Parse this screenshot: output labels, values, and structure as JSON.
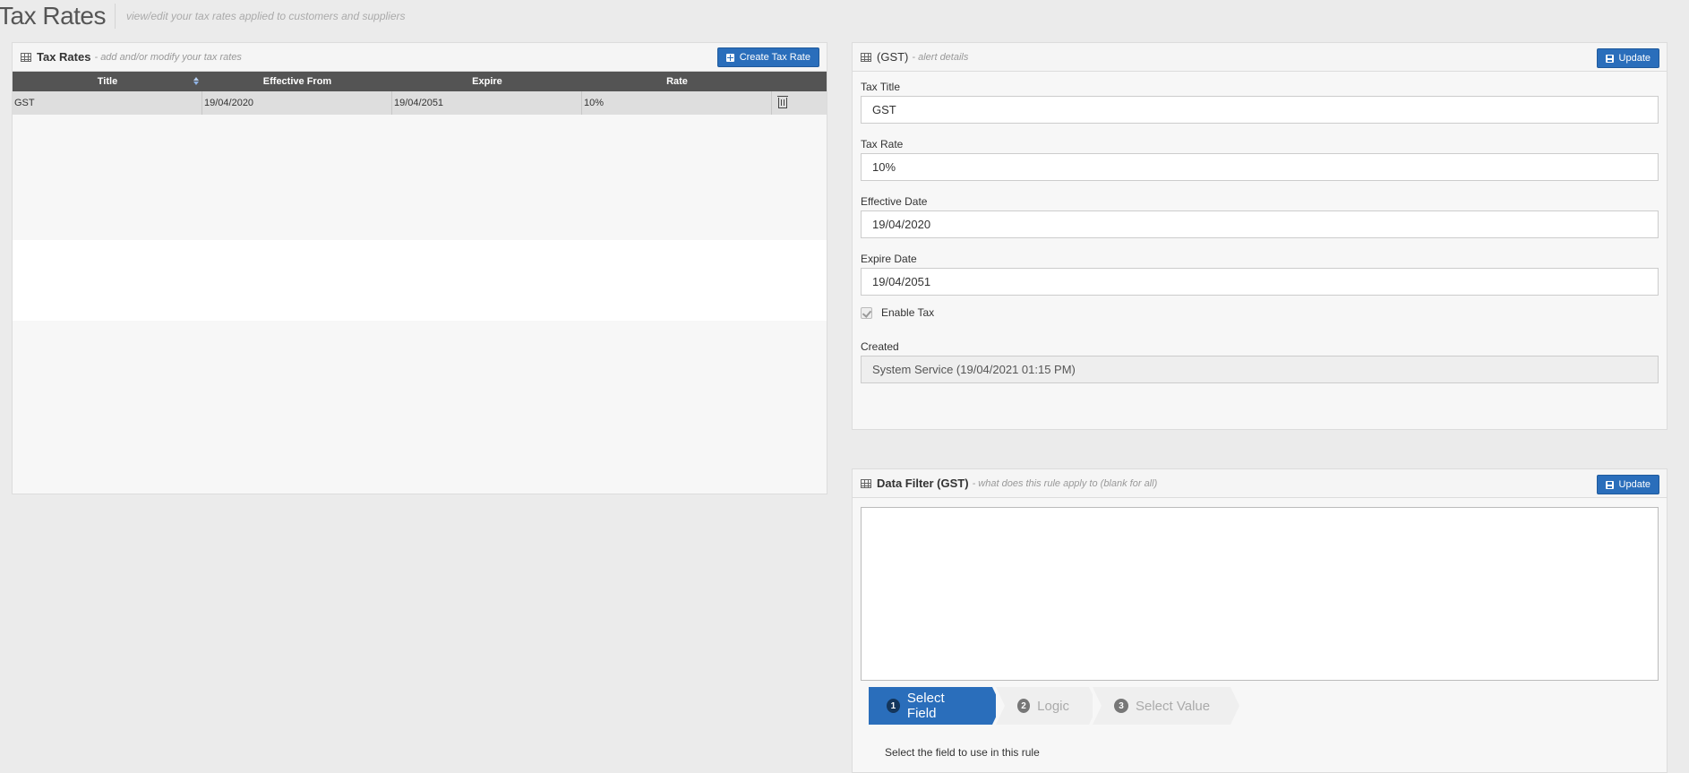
{
  "page": {
    "title": "Tax Rates",
    "subtitle": "view/edit your tax rates applied to customers and suppliers"
  },
  "list_panel": {
    "title": "Tax Rates",
    "subtitle": "- add and/or modify your tax rates",
    "create_button": "Create Tax Rate",
    "columns": [
      "Title",
      "Effective From",
      "Expire",
      "Rate"
    ],
    "rows": [
      {
        "title": "GST",
        "effective_from": "19/04/2020",
        "expire": "19/04/2051",
        "rate": "10%"
      }
    ]
  },
  "detail_panel": {
    "title": "(GST)",
    "subtitle": "- alert details",
    "update_button": "Update",
    "fields": {
      "tax_title_label": "Tax Title",
      "tax_title_value": "GST",
      "tax_rate_label": "Tax Rate",
      "tax_rate_value": "10%",
      "effective_date_label": "Effective Date",
      "effective_date_value": "19/04/2020",
      "expire_date_label": "Expire Date",
      "expire_date_value": "19/04/2051",
      "enable_tax_label": "Enable Tax",
      "enable_tax_checked": true,
      "created_label": "Created",
      "created_value": "System Service (19/04/2021 01:15 PM)"
    }
  },
  "filter_panel": {
    "title": "Data Filter (GST)",
    "subtitle": "- what does this rule apply to (blank for all)",
    "update_button": "Update",
    "steps": [
      {
        "num": "1",
        "label": "Select Field",
        "active": true
      },
      {
        "num": "2",
        "label": "Logic",
        "active": false
      },
      {
        "num": "3",
        "label": "Select Value",
        "active": false
      }
    ],
    "hint": "Select the field to use in this rule"
  },
  "colors": {
    "primary": "#2a6ebb",
    "table_header": "#545454",
    "background": "#ebebeb"
  }
}
